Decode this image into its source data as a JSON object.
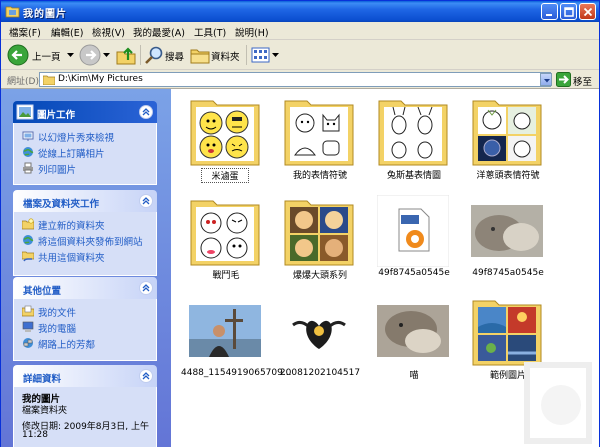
{
  "window": {
    "title": "我的圖片"
  },
  "menu": {
    "items": [
      "檔案(F)",
      "編輯(E)",
      "檢視(V)",
      "我的最愛(A)",
      "工具(T)",
      "說明(H)"
    ]
  },
  "toolbar": {
    "back_label": "上一頁",
    "search_label": "搜尋",
    "folders_label": "資料夾"
  },
  "address": {
    "label": "網址(D)",
    "value": "D:\\Kim\\My Pictures",
    "go_label": "移至"
  },
  "panels": {
    "picture_tasks": {
      "title": "圖片工作",
      "links": [
        "以幻燈片秀來檢視",
        "從線上訂購相片",
        "列印圖片"
      ]
    },
    "file_tasks": {
      "title": "檔案及資料夾工作",
      "links": [
        "建立新的資料夾",
        "將這個資料夾發佈到網站",
        "共用這個資料夾"
      ]
    },
    "other_places": {
      "title": "其他位置",
      "links": [
        "我的文件",
        "我的電腦",
        "網路上的芳鄰"
      ]
    },
    "details": {
      "title": "詳細資料",
      "name": "我的圖片",
      "type": "檔案資料夾",
      "modified_line1": "修改日期: 2009年8月3日, 上午",
      "modified_line2": "11:28"
    }
  },
  "files": [
    {
      "name": "米滷蛋",
      "kind": "folder",
      "selected": true
    },
    {
      "name": "我的表情符號",
      "kind": "folder"
    },
    {
      "name": "兔斯基表情圖",
      "kind": "folder"
    },
    {
      "name": "洋蔥頭表情符號",
      "kind": "folder"
    },
    {
      "name": "戰鬥毛",
      "kind": "folder"
    },
    {
      "name": "爆爆大頭系列",
      "kind": "folder"
    },
    {
      "name": "49f8745a0545e",
      "kind": "ico-file"
    },
    {
      "name": "49f8745a0545e",
      "kind": "photo-cat"
    },
    {
      "name": "4488_1154919065709...",
      "kind": "photo-person"
    },
    {
      "name": "20081202104517",
      "kind": "image-heart"
    },
    {
      "name": "喵",
      "kind": "photo-cat"
    },
    {
      "name": "範例圖片",
      "kind": "folder"
    }
  ],
  "icons": {
    "folder": "folder-icon",
    "back": "back-arrow-icon",
    "forward": "forward-arrow-icon",
    "up": "up-folder-icon",
    "search": "search-icon",
    "views": "views-icon",
    "go": "go-arrow-icon"
  },
  "colors": {
    "titlebar": "#0a5fd8",
    "taskpane": "#7ba2e7",
    "link": "#215dc6",
    "folder": "#f3d266"
  }
}
